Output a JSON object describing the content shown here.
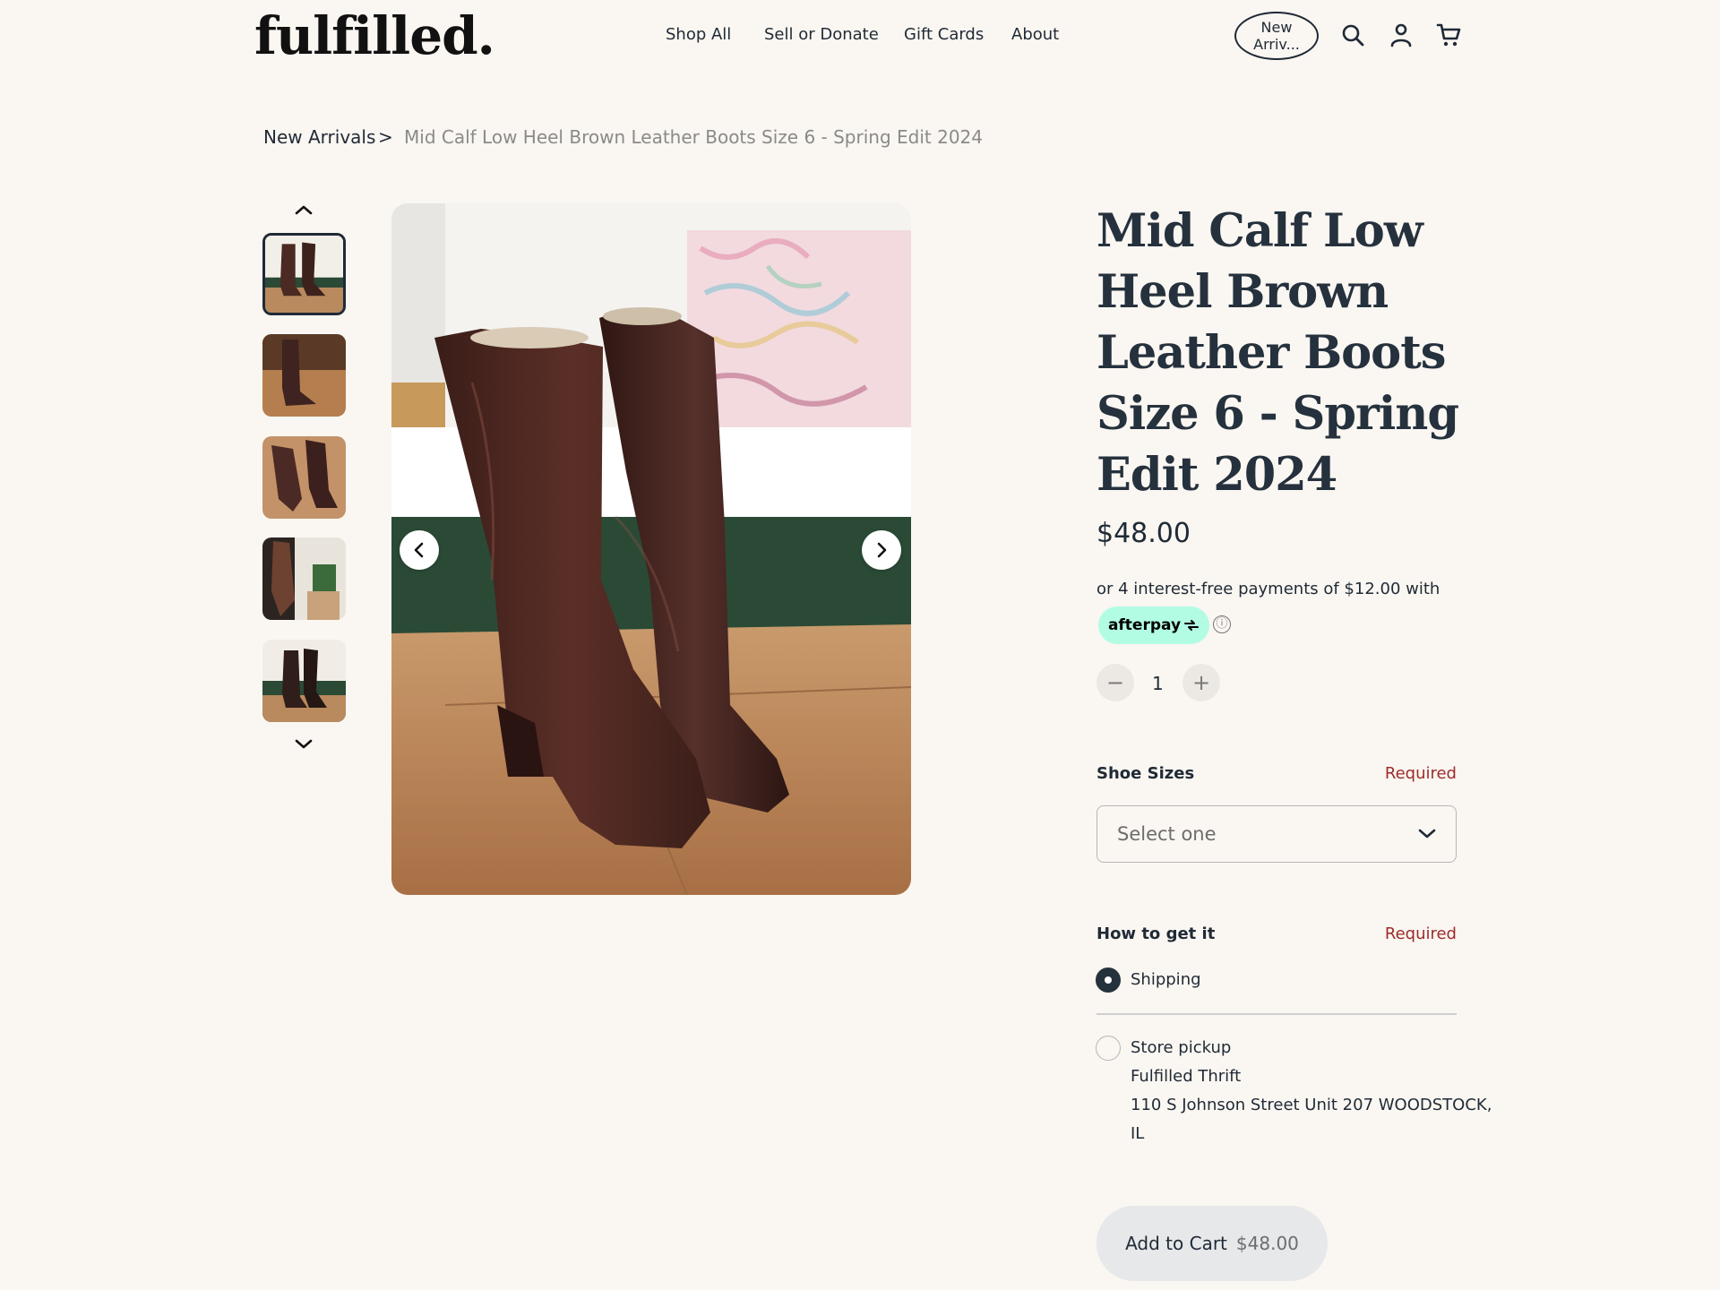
{
  "header": {
    "logo": "fulfilled.",
    "nav": [
      "Shop All",
      "Sell or Donate",
      "Gift Cards",
      "About"
    ],
    "pill_line1": "New",
    "pill_line2": "Arriv...",
    "icons": [
      "search-icon",
      "account-icon",
      "cart-icon"
    ]
  },
  "breadcrumb": {
    "parent": "New Arrivals",
    "separator": ">",
    "current": "Mid Calf Low Heel Brown Leather Boots Size 6 - Spring Edit 2024"
  },
  "gallery": {
    "thumbnail_count": 5,
    "active_index": 0
  },
  "product": {
    "title": "Mid Calf Low Heel Brown Leather Boots Size 6 - Spring Edit 2024",
    "price": "$48.00",
    "afterpay_text": "or 4 interest-free payments of $12.00 with",
    "afterpay_brand": "afterpay",
    "info_glyph": "ⓘ",
    "quantity": "1",
    "qty_minus": "−",
    "qty_plus": "+"
  },
  "shoe_sizes": {
    "label": "Shoe Sizes",
    "required": "Required",
    "selected": "Select one"
  },
  "fulfillment": {
    "label": "How to get it",
    "required": "Required",
    "shipping": "Shipping",
    "pickup": "Store pickup",
    "store_name": "Fulfilled Thrift",
    "address_line1": "110 S Johnson Street Unit 207 WOODSTOCK,",
    "address_line2": "IL",
    "selected": "Shipping"
  },
  "cart": {
    "label": "Add to Cart",
    "amount": "$48.00"
  },
  "colors": {
    "background": "#faf6f1",
    "text": "#1f2a36",
    "required": "#9d2b2b",
    "afterpay": "#b2fce4"
  }
}
